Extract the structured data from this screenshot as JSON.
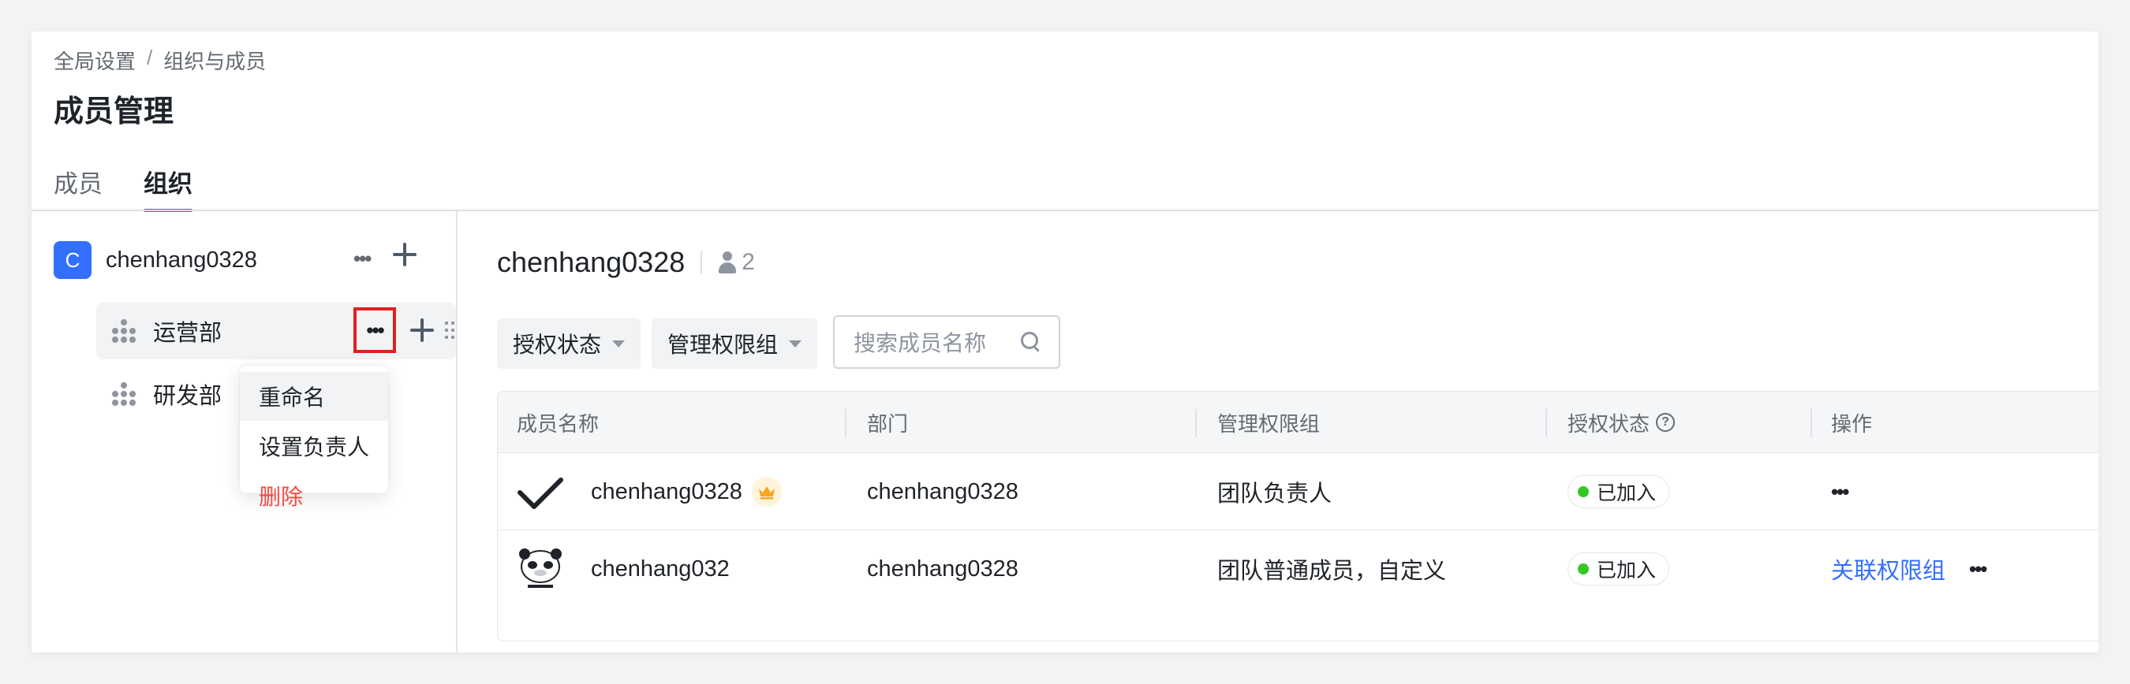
{
  "breadcrumb": {
    "items": [
      "全局设置",
      "组织与成员"
    ],
    "separator": "/"
  },
  "page_title": "成员管理",
  "tabs": [
    {
      "label": "成员",
      "active": false
    },
    {
      "label": "组织",
      "active": true
    }
  ],
  "org_tree": {
    "root": {
      "avatar_letter": "C",
      "name": "chenhang0328"
    },
    "departments": [
      {
        "label": "运营部",
        "hovered": true
      },
      {
        "label": "研发部",
        "hovered": false
      }
    ],
    "context_menu": {
      "items": [
        {
          "label": "重命名",
          "danger": false
        },
        {
          "label": "设置负责人",
          "danger": false
        },
        {
          "label": "删除",
          "danger": true
        }
      ]
    }
  },
  "detail": {
    "title": "chenhang0328",
    "member_count": "2",
    "filters": {
      "auth_status": "授权状态",
      "admin_group": "管理权限组"
    },
    "search": {
      "placeholder": "搜索成员名称"
    },
    "table": {
      "columns": [
        "成员名称",
        "部门",
        "管理权限组",
        "授权状态",
        "操作"
      ],
      "rows": [
        {
          "name": "chenhang0328",
          "is_owner": true,
          "department": "chenhang0328",
          "admin_group": "团队负责人",
          "status": "已加入",
          "action_link": ""
        },
        {
          "name": "chenhang032",
          "is_owner": false,
          "department": "chenhang0328",
          "admin_group": "团队普通成员，自定义",
          "status": "已加入",
          "action_link": "关联权限组"
        }
      ]
    }
  },
  "colors": {
    "accent": "#3370ff",
    "danger": "#f54a45",
    "status_joined": "#34c724",
    "highlight_box": "#e02020"
  }
}
